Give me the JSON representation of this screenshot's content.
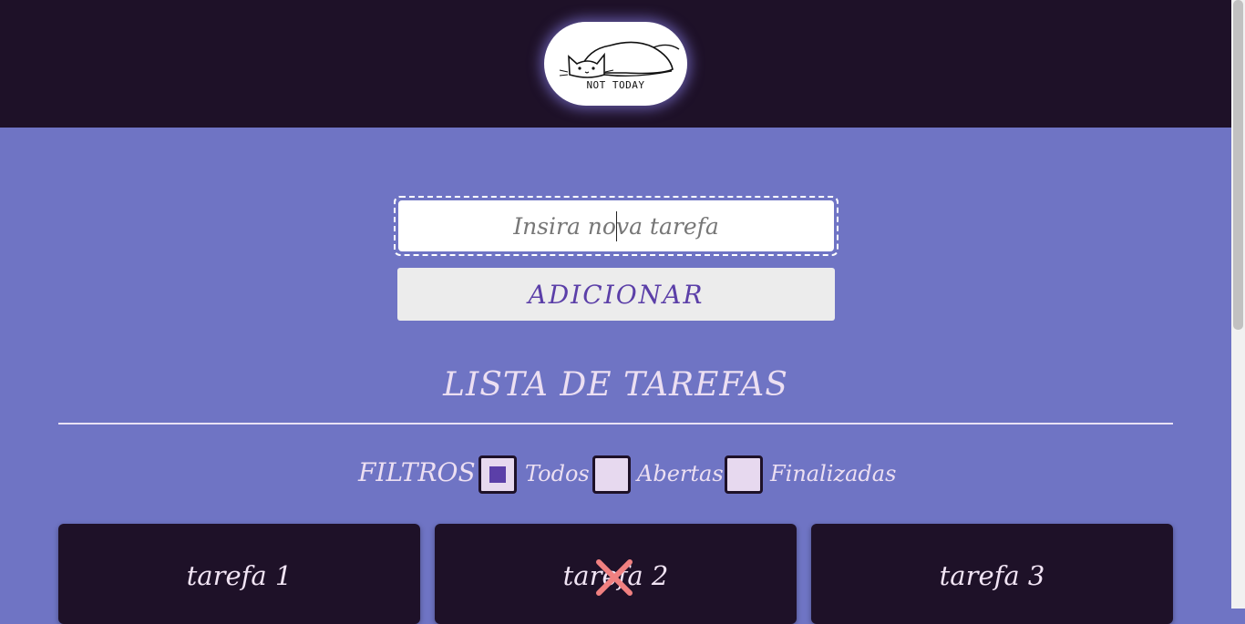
{
  "header": {
    "logo_caption": "NOT TODAY"
  },
  "form": {
    "input_placeholder": "Insira nova tarefa",
    "add_label": "ADICIONAR"
  },
  "list": {
    "title": "LISTA DE TAREFAS"
  },
  "filters": {
    "label": "FILTROS",
    "options": [
      {
        "label": "Todos",
        "checked": true
      },
      {
        "label": "Abertas",
        "checked": false
      },
      {
        "label": "Finalizadas",
        "checked": false
      }
    ]
  },
  "tasks": [
    {
      "text": "tarefa 1",
      "crossed": false
    },
    {
      "text": "tarefa 2",
      "crossed": true
    },
    {
      "text": "tarefa 3",
      "crossed": false
    }
  ],
  "colors": {
    "header_bg": "#1e1128",
    "page_bg": "#6f74c4",
    "accent": "#5b3fa8",
    "cross": "#f08080"
  },
  "icons": {
    "logo": "sleeping-cat-icon",
    "delete": "close-x-icon"
  }
}
